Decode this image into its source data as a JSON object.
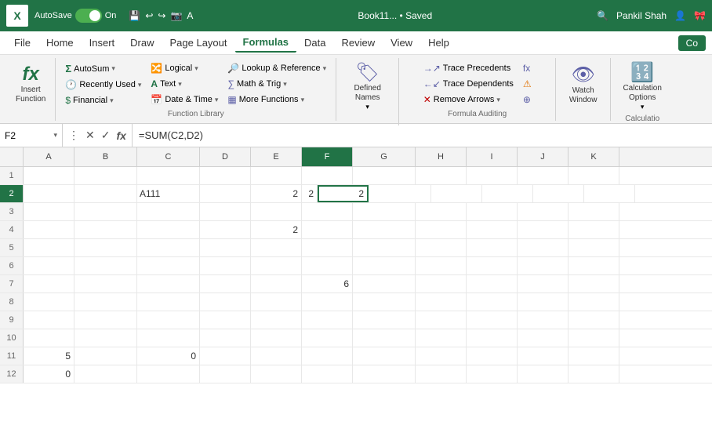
{
  "titlebar": {
    "excel_icon": "X",
    "autosave_label": "AutoSave",
    "toggle_state": "On",
    "title": "Book11... • Saved",
    "user": "Pankil Shah"
  },
  "menubar": {
    "items": [
      "File",
      "Home",
      "Insert",
      "Draw",
      "Page Layout",
      "Formulas",
      "Data",
      "Review",
      "View",
      "Help"
    ],
    "active": "Formulas",
    "co_button": "Co"
  },
  "ribbon": {
    "groups": [
      {
        "name": "insert-function-group",
        "label": "",
        "insert_function": {
          "label_line1": "Insert",
          "label_line2": "Function"
        }
      },
      {
        "name": "function-library",
        "label": "Function Library",
        "rows": [
          {
            "icon": "Σ",
            "label": "AutoSum",
            "has_arrow": true
          },
          {
            "icon": "🕐",
            "label": "Recently Used",
            "has_arrow": true
          },
          {
            "icon": "$",
            "label": "Financial",
            "has_arrow": true
          },
          {
            "icon": "A",
            "label": "Text",
            "has_arrow": true
          },
          {
            "icon": "📅",
            "label": "Date & Time",
            "has_arrow": true
          },
          {
            "icon": "▦",
            "label": "Logical",
            "has_arrow": true
          },
          {
            "icon": "📊",
            "label": "More Functions",
            "has_arrow": true
          }
        ]
      },
      {
        "name": "defined-names",
        "label": "Defined Names",
        "button_label": "Defined\nNames"
      },
      {
        "name": "formula-auditing",
        "label": "Formula Auditing",
        "rows": [
          {
            "icon": "→",
            "label": "Trace Precedents"
          },
          {
            "icon": "←",
            "label": "Trace Dependents"
          },
          {
            "icon": "✕",
            "label": "Remove Arrows",
            "has_arrow": true
          },
          {
            "icon": "fx",
            "label": ""
          }
        ]
      },
      {
        "name": "watch-window",
        "label": "",
        "button_label": "Watch\nWindow"
      },
      {
        "name": "calculation",
        "label": "Calculatio",
        "button_label": "Calculation\nOptions"
      }
    ]
  },
  "formula_bar": {
    "cell_ref": "F2",
    "formula": "=SUM(C2,D2)"
  },
  "columns": [
    "A",
    "B",
    "C",
    "D",
    "E",
    "F",
    "G",
    "H",
    "I",
    "J",
    "K"
  ],
  "rows": [
    {
      "num": 1,
      "cells": [
        "",
        "",
        "",
        "",
        "",
        "",
        "",
        "",
        "",
        "",
        ""
      ]
    },
    {
      "num": 2,
      "cells": [
        "",
        "",
        "A111",
        "",
        "2",
        "2",
        "2",
        "",
        "",
        "",
        ""
      ]
    },
    {
      "num": 3,
      "cells": [
        "",
        "",
        "",
        "",
        "",
        "",
        "",
        "",
        "",
        "",
        ""
      ]
    },
    {
      "num": 4,
      "cells": [
        "",
        "",
        "",
        "",
        "2",
        "",
        "",
        "",
        "",
        "",
        ""
      ]
    },
    {
      "num": 5,
      "cells": [
        "",
        "",
        "",
        "",
        "",
        "",
        "",
        "",
        "",
        "",
        ""
      ]
    },
    {
      "num": 6,
      "cells": [
        "",
        "",
        "",
        "",
        "",
        "",
        "",
        "",
        "",
        "",
        ""
      ]
    },
    {
      "num": 7,
      "cells": [
        "",
        "",
        "",
        "",
        "",
        "6",
        "",
        "",
        "",
        "",
        ""
      ]
    },
    {
      "num": 8,
      "cells": [
        "",
        "",
        "",
        "",
        "",
        "",
        "",
        "",
        "",
        "",
        ""
      ]
    },
    {
      "num": 9,
      "cells": [
        "",
        "",
        "",
        "",
        "",
        "",
        "",
        "",
        "",
        "",
        ""
      ]
    },
    {
      "num": 10,
      "cells": [
        "",
        "",
        "",
        "",
        "",
        "",
        "",
        "",
        "",
        "",
        ""
      ]
    },
    {
      "num": 11,
      "cells": [
        "5",
        "",
        "0",
        "",
        "",
        "",
        "",
        "",
        "",
        "",
        ""
      ]
    },
    {
      "num": 12,
      "cells": [
        "0",
        "",
        "",
        "",
        "",
        "",
        "",
        "",
        "",
        "",
        ""
      ]
    }
  ],
  "selected_cell": {
    "row": 2,
    "col": 5
  }
}
